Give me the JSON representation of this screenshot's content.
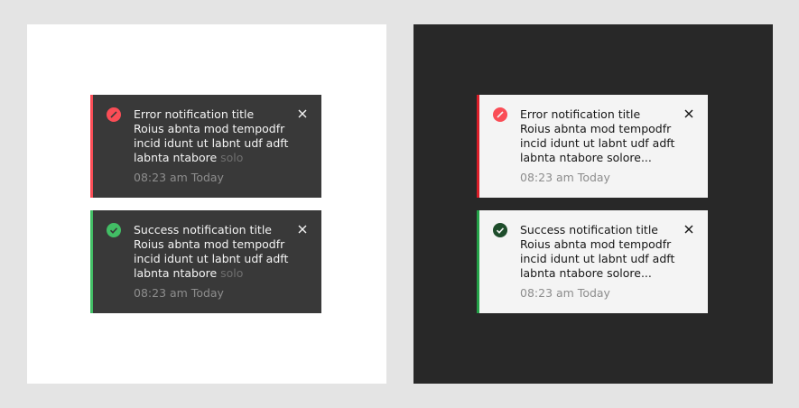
{
  "colors": {
    "background": "#e4e4e4",
    "light_panel": "#ffffff",
    "dark_panel": "#282828",
    "toast_dark": "#393939",
    "toast_light": "#f4f4f4",
    "error": "#da1e28",
    "success": "#24a148"
  },
  "light_panel": {
    "error_toast": {
      "title": "Error notification title",
      "line1": "Roius abnta mod tempodfr",
      "line2": "incid idunt ut labnt udf adft",
      "line3_visible": "labnta ntabore ",
      "line3_faded": "solo",
      "time": "08:23 am Today",
      "icon": "error-icon",
      "close_icon": "close-icon"
    },
    "success_toast": {
      "title": "Success notification title",
      "line1": "Roius abnta mod tempodfr",
      "line2": "incid idunt ut labnt udf adft",
      "line3_visible": "labnta ntabore ",
      "line3_faded": "solo",
      "time": "08:23 am Today",
      "icon": "checkmark-icon",
      "close_icon": "close-icon"
    }
  },
  "dark_panel": {
    "error_toast": {
      "title": "Error notification title",
      "line1": "Roius abnta mod tempodfr",
      "line2": "incid idunt ut labnt udf adft",
      "line3": "labnta ntabore solore...",
      "time": "08:23 am Today",
      "icon": "error-icon",
      "close_icon": "close-icon"
    },
    "success_toast": {
      "title": "Success notification title",
      "line1": "Roius abnta mod tempodfr",
      "line2": "incid idunt ut labnt udf adft",
      "line3": "labnta ntabore solore...",
      "time": "08:23 am Today",
      "icon": "checkmark-icon",
      "close_icon": "close-icon"
    }
  }
}
